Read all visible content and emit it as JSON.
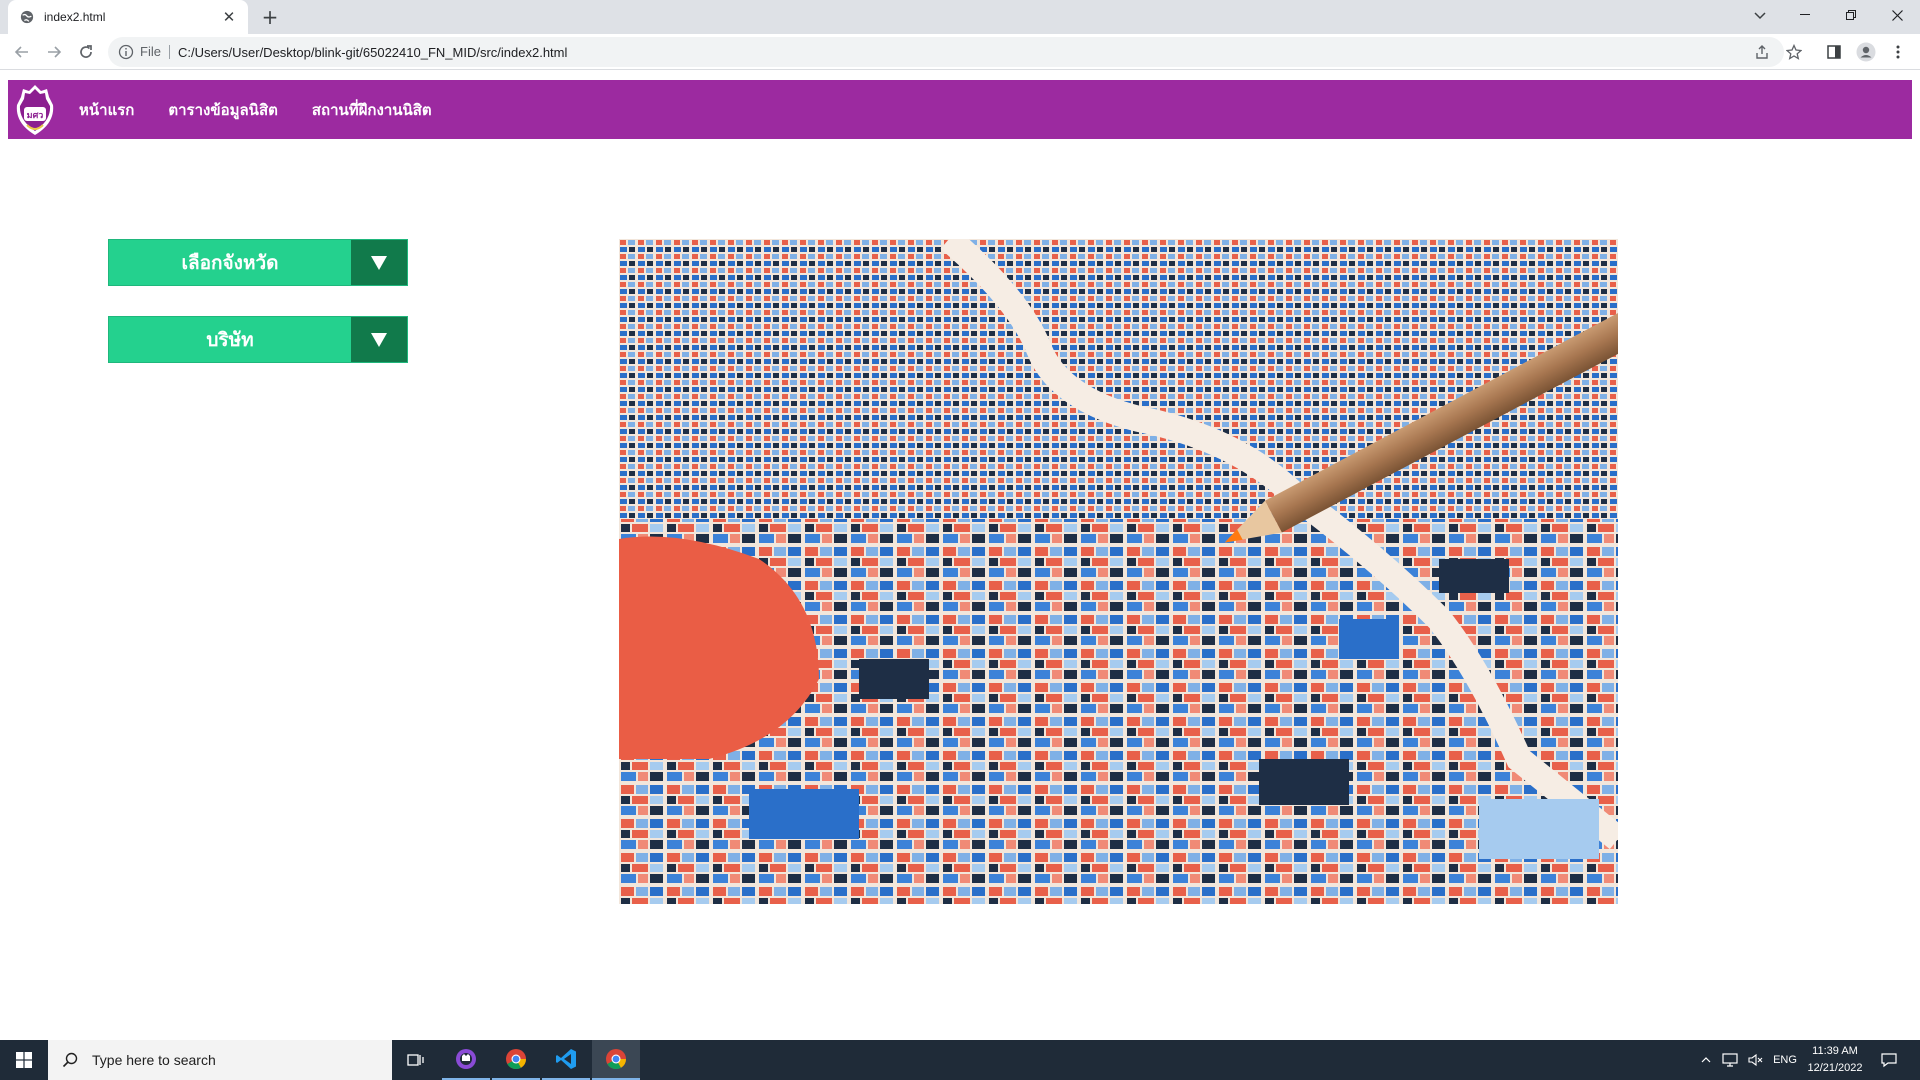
{
  "browser": {
    "tab": {
      "title": "index2.html",
      "close": "✕"
    },
    "new_tab": "+",
    "address": {
      "scheme": "File",
      "url": "C:/Users/User/Desktop/blink-git/65022410_FN_MID/src/index2.html"
    }
  },
  "site": {
    "nav": [
      {
        "label": "หน้าแรก"
      },
      {
        "label": "ตารางข้อมูลนิสิต"
      },
      {
        "label": "สถานที่ฝึกงานนิสิต"
      }
    ],
    "logo_text": "มศว",
    "dropdowns": [
      {
        "label": "เลือกจังหวัด"
      },
      {
        "label": "บริษัท"
      }
    ],
    "accent_color": "#9c2aa0",
    "button_color": "#24d18e",
    "button_arrow_color": "#117a4b"
  },
  "taskbar": {
    "search_placeholder": "Type here to search",
    "language": "ENG",
    "time": "11:39 AM",
    "date": "12/21/2022"
  }
}
